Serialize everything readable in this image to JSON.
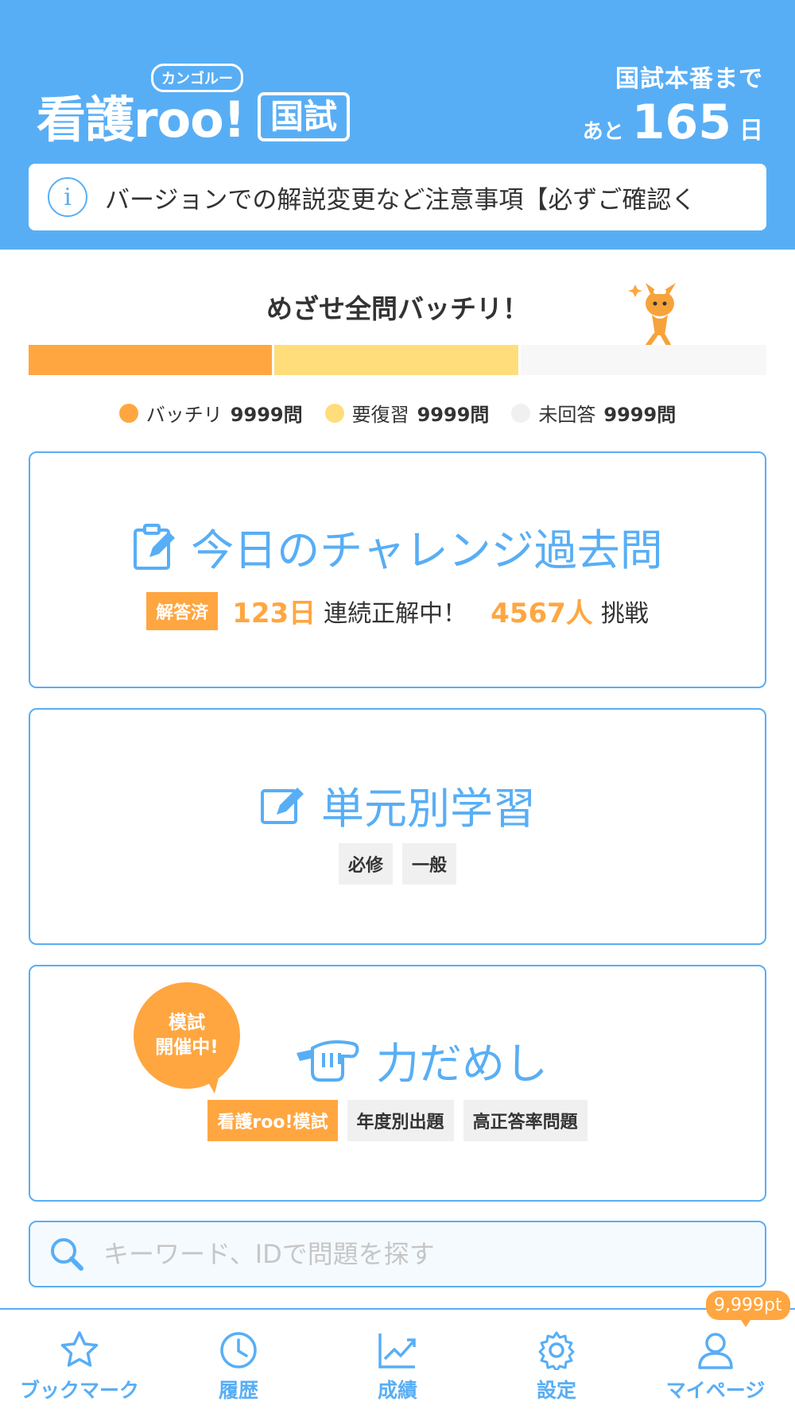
{
  "header": {
    "logo_main": "看護roo!",
    "logo_kana": "カンゴルー",
    "logo_badge": "国試",
    "countdown_label": "国試本番まで",
    "countdown_prefix": "あと",
    "countdown_days": "165",
    "countdown_unit": "日",
    "notice_text": "バージョンでの解説変更など注意事項【必ずご確認く"
  },
  "progress": {
    "title": "めざせ全問バッチリ！",
    "ok_fraction": 0.333,
    "review_fraction": 0.334,
    "legend": [
      {
        "label": "バッチリ",
        "count": "9999問",
        "color": "#ffa640"
      },
      {
        "label": "要復習",
        "count": "9999問",
        "color": "#ffdd7a"
      },
      {
        "label": "未回答",
        "count": "9999問",
        "color": "#f0f0f0"
      }
    ]
  },
  "challenge": {
    "title": "今日のチャレンジ過去問",
    "answered_tag": "解答済",
    "streak_value": "123日",
    "streak_label": "連続正解中！",
    "challengers_value": "4567人",
    "challengers_label": "挑戦"
  },
  "unit": {
    "title": "単元別学習",
    "tags": [
      "必修",
      "一般"
    ]
  },
  "trial": {
    "title": "力だめし",
    "bubble_line1": "模試",
    "bubble_line2": "開催中!",
    "tags": [
      "看護roo!模試",
      "年度別出題",
      "高正答率問題"
    ]
  },
  "search": {
    "placeholder": "キーワード、IDで問題を探す"
  },
  "tabbar": {
    "points": "9,999pt",
    "items": [
      {
        "label": "ブックマーク",
        "icon": "star-icon"
      },
      {
        "label": "履歴",
        "icon": "clock-icon"
      },
      {
        "label": "成績",
        "icon": "chart-icon"
      },
      {
        "label": "設定",
        "icon": "gear-icon"
      },
      {
        "label": "マイページ",
        "icon": "user-icon"
      }
    ]
  },
  "colors": {
    "primary": "#58aef5",
    "accent": "#ffa640",
    "review": "#ffdd7a"
  }
}
